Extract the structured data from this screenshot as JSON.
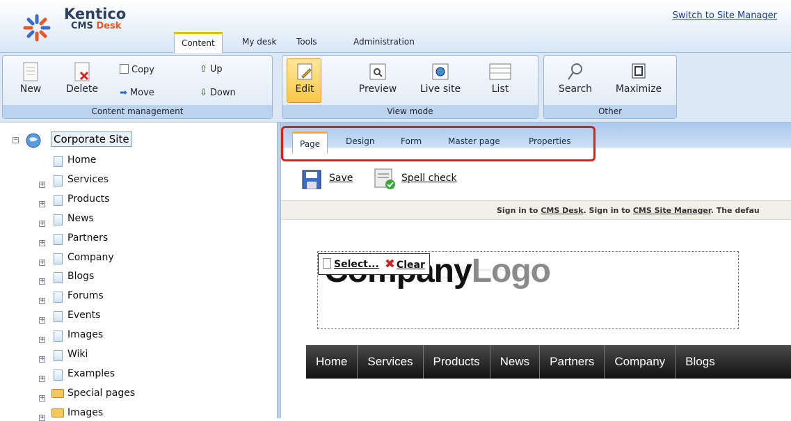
{
  "header": {
    "brand": "Kentico",
    "product_prefix": "CMS ",
    "product_suffix": "Desk",
    "switch_link": "Switch to Site Manager",
    "tabs": [
      {
        "label": "Content"
      },
      {
        "label": "My desk"
      },
      {
        "label": "Tools"
      },
      {
        "label": "Administration"
      }
    ]
  },
  "ribbon": {
    "content_management": {
      "caption": "Content management",
      "new": "New",
      "delete": "Delete",
      "copy": "Copy",
      "move": "Move",
      "up": "Up",
      "down": "Down"
    },
    "view_mode": {
      "caption": "View mode",
      "edit": "Edit",
      "preview": "Preview",
      "live_site": "Live site",
      "list": "List"
    },
    "other": {
      "caption": "Other",
      "search": "Search",
      "maximize": "Maximize"
    }
  },
  "tree": {
    "root": "Corporate Site",
    "items": [
      {
        "label": "Home"
      },
      {
        "label": "Services"
      },
      {
        "label": "Products"
      },
      {
        "label": "News"
      },
      {
        "label": "Partners"
      },
      {
        "label": "Company"
      },
      {
        "label": "Blogs"
      },
      {
        "label": "Forums"
      },
      {
        "label": "Events"
      },
      {
        "label": "Images"
      },
      {
        "label": "Wiki"
      },
      {
        "label": "Examples"
      },
      {
        "label": "Special pages"
      },
      {
        "label": "Images"
      }
    ]
  },
  "editor": {
    "tabs": [
      {
        "label": "Page"
      },
      {
        "label": "Design"
      },
      {
        "label": "Form"
      },
      {
        "label": "Master page"
      },
      {
        "label": "Properties"
      }
    ],
    "actions": {
      "save": "Save",
      "spell": "Spell check"
    },
    "info": {
      "t1": "Sign in to ",
      "l1": "CMS Desk",
      "t2": ". Sign in to ",
      "l2": "CMS Site Manager",
      "t3": ". The defau"
    },
    "logo": {
      "main": "Company",
      "accent": "Logo",
      "select": "Select...",
      "clear": "Clear"
    },
    "nav": [
      {
        "label": "Home"
      },
      {
        "label": "Services"
      },
      {
        "label": "Products"
      },
      {
        "label": "News"
      },
      {
        "label": "Partners"
      },
      {
        "label": "Company"
      },
      {
        "label": "Blogs"
      }
    ]
  },
  "colors": {
    "accent": "#f5b800",
    "highlight_box": "#e01b1b",
    "brand_orange": "#e8572a"
  }
}
